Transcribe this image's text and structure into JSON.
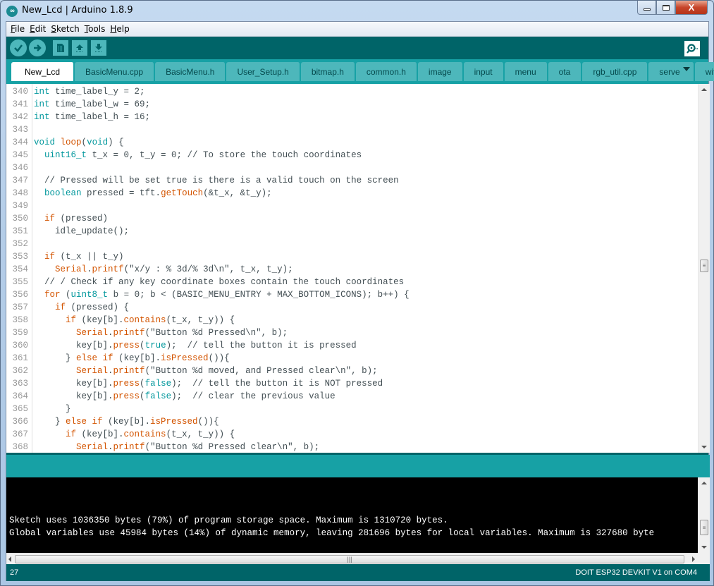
{
  "window": {
    "title": "New_Lcd | Arduino 1.8.9",
    "app_icon": "arduino-logo-icon",
    "controls": [
      "minimize",
      "maximize",
      "close"
    ],
    "close_glyph": "X"
  },
  "menubar": {
    "items": [
      {
        "label": "File",
        "mnemonic": "F",
        "rest": "ile"
      },
      {
        "label": "Edit",
        "mnemonic": "E",
        "rest": "dit"
      },
      {
        "label": "Sketch",
        "mnemonic": "S",
        "rest": "ketch"
      },
      {
        "label": "Tools",
        "mnemonic": "T",
        "rest": "ools"
      },
      {
        "label": "Help",
        "mnemonic": "H",
        "rest": "elp"
      }
    ]
  },
  "toolbar": {
    "buttons": [
      {
        "name": "verify",
        "icon": "checkmark-icon"
      },
      {
        "name": "upload",
        "icon": "arrow-right-icon"
      },
      {
        "name": "new",
        "icon": "new-sketch-icon"
      },
      {
        "name": "open",
        "icon": "arrow-up-icon"
      },
      {
        "name": "save",
        "icon": "arrow-down-icon"
      }
    ],
    "serial_monitor_icon": "serial-monitor-icon"
  },
  "tabs": [
    {
      "label": "New_Lcd",
      "active": true
    },
    {
      "label": "BasicMenu.cpp"
    },
    {
      "label": "BasicMenu.h"
    },
    {
      "label": "User_Setup.h"
    },
    {
      "label": "bitmap.h"
    },
    {
      "label": "common.h"
    },
    {
      "label": "image"
    },
    {
      "label": "input"
    },
    {
      "label": "menu"
    },
    {
      "label": "ota"
    },
    {
      "label": "rgb_util.cpp"
    },
    {
      "label": "server"
    },
    {
      "label": "wifi"
    }
  ],
  "editor": {
    "lines": [
      {
        "n": "340",
        "code": [
          [
            "kw",
            "int"
          ],
          [
            "",
            " time_label_y = 2;"
          ]
        ]
      },
      {
        "n": "341",
        "code": [
          [
            "kw",
            "int"
          ],
          [
            "",
            " time_label_w = 69;"
          ]
        ]
      },
      {
        "n": "342",
        "code": [
          [
            "kw",
            "int"
          ],
          [
            "",
            " time_label_h = 16;"
          ]
        ]
      },
      {
        "n": "343",
        "code": []
      },
      {
        "n": "344",
        "code": [
          [
            "kw",
            "void"
          ],
          [
            "",
            " "
          ],
          [
            "fn",
            "loop"
          ],
          [
            "",
            "("
          ],
          [
            "kw",
            "void"
          ],
          [
            "",
            ") {"
          ]
        ]
      },
      {
        "n": "345",
        "code": [
          [
            "",
            "  "
          ],
          [
            "kw",
            "uint16_t"
          ],
          [
            "",
            " t_x = 0, t_y = 0; // To store the touch coordinates"
          ]
        ]
      },
      {
        "n": "346",
        "code": []
      },
      {
        "n": "347",
        "code": [
          [
            "",
            "  // Pressed will be set true is there is a valid touch on the screen"
          ]
        ]
      },
      {
        "n": "348",
        "code": [
          [
            "",
            "  "
          ],
          [
            "kw",
            "boolean"
          ],
          [
            "",
            " pressed = tft."
          ],
          [
            "fn",
            "getTouch"
          ],
          [
            "",
            "(&t_x, &t_y);"
          ]
        ]
      },
      {
        "n": "349",
        "code": []
      },
      {
        "n": "350",
        "code": [
          [
            "",
            "  "
          ],
          [
            "fn",
            "if"
          ],
          [
            "",
            " (pressed)"
          ]
        ]
      },
      {
        "n": "351",
        "code": [
          [
            "",
            "    idle_update();"
          ]
        ]
      },
      {
        "n": "352",
        "code": []
      },
      {
        "n": "353",
        "code": [
          [
            "",
            "  "
          ],
          [
            "fn",
            "if"
          ],
          [
            "",
            " (t_x || t_y)"
          ]
        ]
      },
      {
        "n": "354",
        "code": [
          [
            "",
            "    "
          ],
          [
            "fn",
            "Serial"
          ],
          [
            "",
            "."
          ],
          [
            "fn",
            "printf"
          ],
          [
            "",
            "(\"x/y : % 3d/% 3d\\n\", t_x, t_y);"
          ]
        ]
      },
      {
        "n": "355",
        "code": [
          [
            "",
            "  // / Check if any key coordinate boxes contain the touch coordinates"
          ]
        ]
      },
      {
        "n": "356",
        "code": [
          [
            "",
            "  "
          ],
          [
            "fn",
            "for"
          ],
          [
            "",
            " ("
          ],
          [
            "kw",
            "uint8_t"
          ],
          [
            "",
            " b = 0; b < (BASIC_MENU_ENTRY + MAX_BOTTOM_ICONS); b++) {"
          ]
        ]
      },
      {
        "n": "357",
        "code": [
          [
            "",
            "    "
          ],
          [
            "fn",
            "if"
          ],
          [
            "",
            " (pressed) {"
          ]
        ]
      },
      {
        "n": "358",
        "code": [
          [
            "",
            "      "
          ],
          [
            "fn",
            "if"
          ],
          [
            "",
            " (key[b]."
          ],
          [
            "fn",
            "contains"
          ],
          [
            "",
            "(t_x, t_y)) {"
          ]
        ]
      },
      {
        "n": "359",
        "code": [
          [
            "",
            "        "
          ],
          [
            "fn",
            "Serial"
          ],
          [
            "",
            "."
          ],
          [
            "fn",
            "printf"
          ],
          [
            "",
            "(\"Button %d Pressed\\n\", b);"
          ]
        ]
      },
      {
        "n": "360",
        "code": [
          [
            "",
            "        key[b]."
          ],
          [
            "fn",
            "press"
          ],
          [
            "",
            "("
          ],
          [
            "kw",
            "true"
          ],
          [
            "",
            ");  // tell the button it is pressed"
          ]
        ]
      },
      {
        "n": "361",
        "code": [
          [
            "",
            "      } "
          ],
          [
            "fn",
            "else if"
          ],
          [
            "",
            " (key[b]."
          ],
          [
            "fn",
            "isPressed"
          ],
          [
            "",
            "()){"
          ]
        ]
      },
      {
        "n": "362",
        "code": [
          [
            "",
            "        "
          ],
          [
            "fn",
            "Serial"
          ],
          [
            "",
            "."
          ],
          [
            "fn",
            "printf"
          ],
          [
            "",
            "(\"Button %d moved, and Pressed clear\\n\", b);"
          ]
        ]
      },
      {
        "n": "363",
        "code": [
          [
            "",
            "        key[b]."
          ],
          [
            "fn",
            "press"
          ],
          [
            "",
            "("
          ],
          [
            "kw",
            "false"
          ],
          [
            "",
            ");  // tell the button it is NOT pressed"
          ]
        ]
      },
      {
        "n": "364",
        "code": [
          [
            "",
            "        key[b]."
          ],
          [
            "fn",
            "press"
          ],
          [
            "",
            "("
          ],
          [
            "kw",
            "false"
          ],
          [
            "",
            ");  // clear the previous value"
          ]
        ]
      },
      {
        "n": "365",
        "code": [
          [
            "",
            "      }"
          ]
        ]
      },
      {
        "n": "366",
        "code": [
          [
            "",
            "    } "
          ],
          [
            "fn",
            "else if"
          ],
          [
            "",
            " (key[b]."
          ],
          [
            "fn",
            "isPressed"
          ],
          [
            "",
            "()){"
          ]
        ]
      },
      {
        "n": "367",
        "code": [
          [
            "",
            "      "
          ],
          [
            "fn",
            "if"
          ],
          [
            "",
            " (key[b]."
          ],
          [
            "fn",
            "contains"
          ],
          [
            "",
            "(t_x, t_y)) {"
          ]
        ]
      },
      {
        "n": "368",
        "code": [
          [
            "",
            "        "
          ],
          [
            "fn",
            "Serial"
          ],
          [
            "",
            "."
          ],
          [
            "fn",
            "printf"
          ],
          [
            "",
            "(\"Button %d Pressed clear\\n\", b);"
          ]
        ]
      }
    ],
    "scroll_position": 0.5
  },
  "console": {
    "lines": [
      "Sketch uses 1036350 bytes (79%) of program storage space. Maximum is 1310720 bytes.",
      "Global variables use 45984 bytes (14%) of dynamic memory, leaving 281696 bytes for local variables. Maximum is 327680 byte"
    ]
  },
  "footer": {
    "line_number": "27",
    "board": "DOIT ESP32 DEVKIT V1 on COM4"
  },
  "colors": {
    "teal_dark": "#006468",
    "teal_mid": "#17a1a5",
    "teal_light": "#4db7bb",
    "keyword": "#00979c",
    "function": "#d35400"
  }
}
